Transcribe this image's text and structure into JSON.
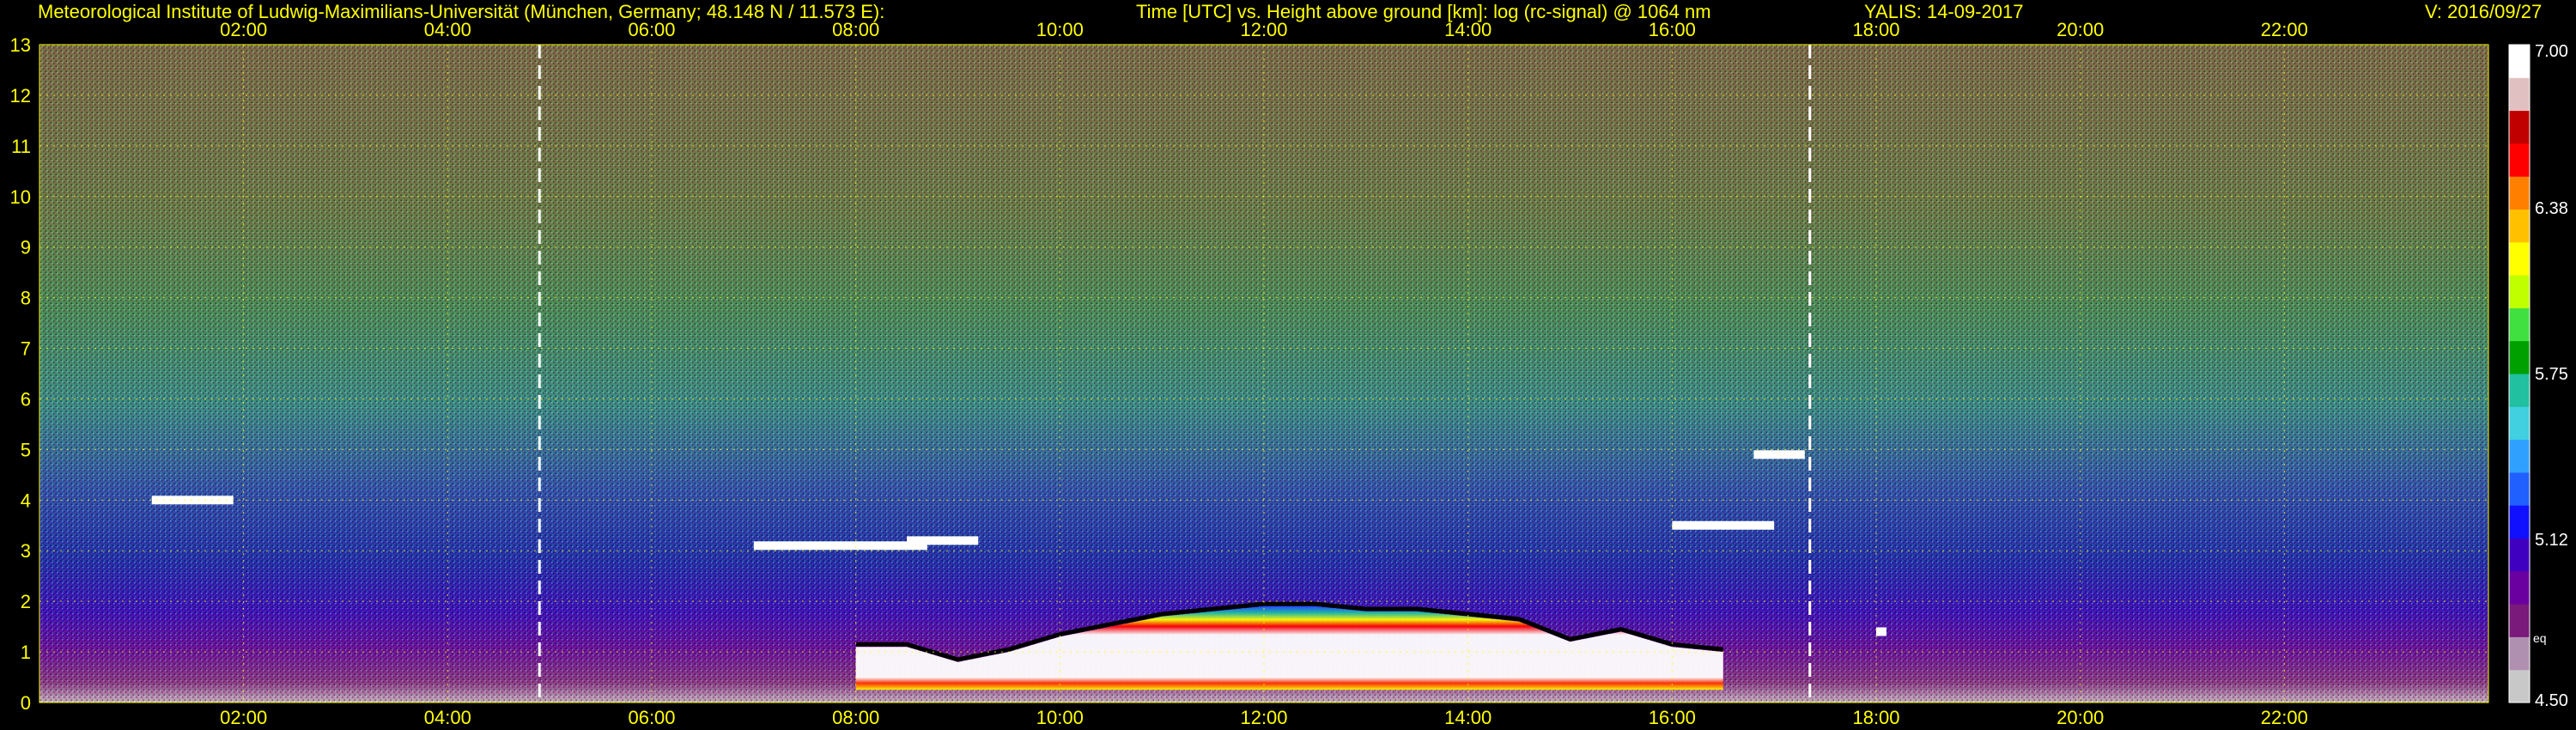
{
  "header": {
    "institute": "Meteorological Institute of Ludwig-Maximilians-Universität (München, Germany; 48.148 N / 11.573 E):",
    "plot_title": "Time [UTC] vs. Height above ground [km]: log (rc-signal) @ 1064 nm",
    "instrument": "YALIS: 14-09-2017",
    "version": "V: 2016/09/27"
  },
  "colors": {
    "background": "#000000",
    "text": "#ffff00",
    "grid": "#ffff00",
    "colorbar_text": "#ffffff"
  },
  "chart_data": {
    "type": "heatmap",
    "title": "Time [UTC] vs. Height above ground [km]: log (rc-signal) @ 1064 nm",
    "x_unit": "hours UTC",
    "xlim": [
      0,
      24
    ],
    "x_ticks": [
      2,
      4,
      6,
      8,
      10,
      12,
      14,
      16,
      18,
      20,
      22
    ],
    "x_tick_labels": [
      "02:00",
      "04:00",
      "06:00",
      "08:00",
      "10:00",
      "12:00",
      "14:00",
      "16:00",
      "18:00",
      "20:00",
      "22:00"
    ],
    "ylim": [
      0,
      13
    ],
    "y_ticks": [
      0,
      1,
      2,
      3,
      4,
      5,
      6,
      7,
      8,
      9,
      10,
      11,
      12,
      13
    ],
    "y_tick_labels": [
      "0",
      "1",
      "2",
      "3",
      "4",
      "5",
      "6",
      "7",
      "8",
      "9",
      "10",
      "11",
      "12",
      "13"
    ],
    "grid": true,
    "sunrise_sunset_lines": [
      4.9,
      17.35
    ],
    "colorbar": {
      "min": 4.5,
      "max": 7.0,
      "tick_values": [
        4.5,
        5.12,
        5.75,
        6.38,
        7.0
      ],
      "tick_labels": [
        "4.50",
        "5.12",
        "5.75",
        "6.38",
        "7.00"
      ],
      "unit_label": "eq",
      "colors": [
        "#c8c8c8",
        "#b090b0",
        "#7a1a7a",
        "#6a00a0",
        "#4000c0",
        "#1010ff",
        "#2060ff",
        "#30a0ff",
        "#40d0e0",
        "#20c0a0",
        "#00a000",
        "#40e040",
        "#c0ff00",
        "#ffff00",
        "#ffc000",
        "#ff8000",
        "#ff0000",
        "#c00000",
        "#e0c0c0",
        "#ffffff"
      ]
    },
    "boundary_layer_top_km": {
      "x": [
        8.0,
        8.5,
        9.0,
        9.5,
        10.0,
        10.5,
        11.0,
        11.5,
        12.0,
        12.5,
        13.0,
        13.5,
        14.0,
        14.5,
        15.0,
        15.5,
        16.0,
        16.5
      ],
      "y": [
        1.1,
        1.1,
        0.8,
        1.0,
        1.3,
        1.5,
        1.7,
        1.8,
        1.9,
        1.9,
        1.8,
        1.8,
        1.7,
        1.6,
        1.2,
        1.4,
        1.1,
        1.0
      ]
    },
    "cloud_layers": [
      {
        "x": [
          1.1,
          1.9
        ],
        "y": 4.0
      },
      {
        "x": [
          7.0,
          8.7
        ],
        "y": 3.1
      },
      {
        "x": [
          8.5,
          9.2
        ],
        "y": 3.2
      },
      {
        "x": [
          16.0,
          17.0
        ],
        "y": 3.5
      },
      {
        "x": [
          16.8,
          17.3
        ],
        "y": 4.9
      },
      {
        "x": [
          18.0,
          18.1
        ],
        "y": 1.4
      }
    ]
  }
}
